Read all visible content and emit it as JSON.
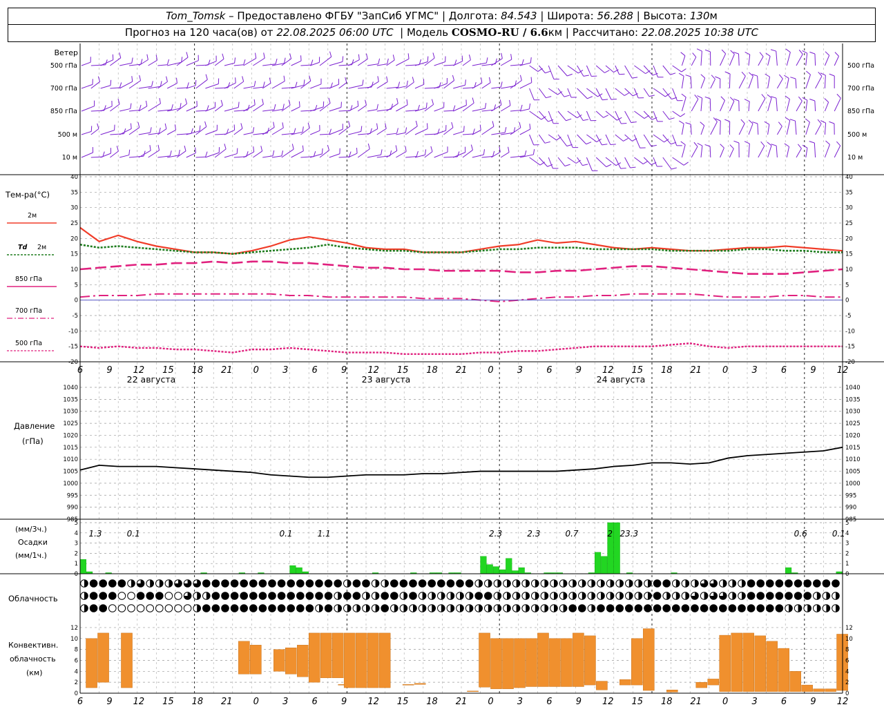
{
  "header": {
    "station": "Tom_Tomsk",
    "provider": "– Предоставлено ФГБУ \"ЗапСиб УГМС\"",
    "lon_label": "Долгота:",
    "lon": "84.543",
    "lat_label": "Широта:",
    "lat": "56.288",
    "alt_label": "Высота:",
    "alt": "130",
    "alt_unit": "м",
    "forecast_label": "Прогноз на 120 часа(ов) от",
    "issued": "22.08.2025 06:00 UTC",
    "model_label": "Модель",
    "model": "COSMO-RU / 6.6",
    "model_unit": "км",
    "calc_label": "Рассчитано:",
    "calc": "22.08.2025 10:38 UTC"
  },
  "time_axis": {
    "hour_ticks": [
      "6",
      "9",
      "12",
      "15",
      "18",
      "21",
      "0",
      "3",
      "6",
      "9",
      "12",
      "15",
      "18",
      "21",
      "0",
      "3",
      "6",
      "9",
      "12",
      "15",
      "18",
      "21",
      "0",
      "3",
      "6",
      "9",
      "12"
    ],
    "days": [
      "22 августа",
      "23 августа",
      "24 августа"
    ]
  },
  "wind_panel": {
    "title": "Ветер",
    "levels": [
      "500 гПа",
      "700 гПа",
      "850 гПа",
      "500 м",
      "10 м"
    ],
    "color": "#7a1fd0"
  },
  "temp_panel": {
    "title": "Тем-ра(°C)",
    "legend": {
      "t2m": "2м",
      "td_prefix": "Td",
      "td_suffix": "2м",
      "t850": "850 гПа",
      "t700": "700 гПа",
      "t500": "500 гПа"
    },
    "y_ticks": [
      "40",
      "35",
      "30",
      "25",
      "20",
      "15",
      "10",
      "5",
      "0",
      "-5",
      "-10",
      "-15",
      "-20"
    ]
  },
  "pressure_panel": {
    "title": "Давление",
    "unit": "(гПа)",
    "y_ticks": [
      "1040",
      "1035",
      "1030",
      "1025",
      "1020",
      "1015",
      "1010",
      "1005",
      "1000",
      "995",
      "990",
      "985"
    ]
  },
  "precip_panel": {
    "label1": "(мм/3ч.)",
    "label2": "Осадки",
    "label3": "(мм/1ч.)",
    "y_ticks": [
      "5",
      "4",
      "3",
      "2",
      "1",
      "0"
    ],
    "totals": [
      "1.3",
      "0.1",
      "0.1",
      "1.1",
      "2.3",
      "2.3",
      "0.7",
      "2",
      "23.3",
      "0.6",
      "0.1"
    ]
  },
  "cloud_panel": {
    "title": "Облачность"
  },
  "convective_panel": {
    "title1": "Конвективн.",
    "title2": "облачность",
    "title3": "(км)",
    "y_ticks": [
      "12",
      "10",
      "8",
      "6",
      "4",
      "2",
      "0"
    ]
  },
  "colors": {
    "t2m": "#f03c28",
    "td": "#1e7d1e",
    "upper": "#e0207e",
    "precip": "#22d622",
    "conv": "#f0902e",
    "pressure": "#000000"
  },
  "chart_data": [
    {
      "type": "line",
      "title": "Тем-ра(°C)",
      "x_unit": "hours since 22.08.2025 06:00 UTC",
      "x": [
        0,
        3,
        6,
        9,
        12,
        15,
        18,
        21,
        24,
        27,
        30,
        33,
        36,
        39,
        42,
        45,
        48,
        51,
        54,
        57,
        60,
        63,
        66,
        69,
        72,
        75,
        78,
        81,
        84,
        87,
        90,
        93,
        96,
        99,
        102,
        105,
        108,
        111,
        114,
        117,
        120
      ],
      "ylim": [
        -20,
        40
      ],
      "series": [
        {
          "name": "2м",
          "values": [
            23.5,
            19,
            21,
            19,
            17.5,
            16.5,
            15.5,
            15.5,
            15,
            16,
            17.5,
            19.5,
            20.5,
            19.5,
            18.5,
            17,
            16.5,
            16.5,
            15.5,
            15.5,
            15.5,
            16.5,
            17.5,
            18,
            19.5,
            18.5,
            19,
            18,
            17,
            16.5,
            17,
            16.5,
            16,
            16,
            16.5,
            17,
            17,
            17.5,
            17,
            16.5,
            16
          ]
        },
        {
          "name": "Td 2м",
          "values": [
            18,
            17,
            17.5,
            17,
            16.5,
            16,
            15.5,
            15.5,
            15,
            15.5,
            16,
            16.5,
            17,
            18,
            17,
            16.5,
            16,
            16,
            15.5,
            15.5,
            15.5,
            16,
            16.5,
            16.5,
            17,
            17,
            17,
            16.5,
            16.5,
            16.5,
            16.5,
            16,
            16,
            16,
            16,
            16.5,
            16.5,
            16,
            16,
            15.5,
            15.5
          ]
        },
        {
          "name": "850 гПа",
          "values": [
            10,
            10.5,
            11,
            11.5,
            11.5,
            12,
            12,
            12.5,
            12,
            12.5,
            12.5,
            12,
            12,
            11.5,
            11,
            10.5,
            10.5,
            10,
            10,
            9.5,
            9.5,
            9.5,
            9.5,
            9,
            9,
            9.5,
            9.5,
            10,
            10.5,
            11,
            11,
            10.5,
            10,
            9.5,
            9,
            8.5,
            8.5,
            8.5,
            9,
            9.5,
            10
          ]
        },
        {
          "name": "700 гПа",
          "values": [
            1,
            1.5,
            1.5,
            1.5,
            2,
            2,
            2,
            2,
            2,
            2,
            2,
            1.5,
            1.5,
            1,
            1,
            1,
            1,
            1,
            0.5,
            0.5,
            0.5,
            0,
            -0.5,
            0,
            0.5,
            1,
            1,
            1.5,
            1.5,
            2,
            2,
            2,
            2,
            1.5,
            1,
            1,
            1,
            1.5,
            1.5,
            1,
            1
          ]
        },
        {
          "name": "500 гПа",
          "values": [
            -15,
            -15.5,
            -15,
            -15.5,
            -15.5,
            -16,
            -16,
            -16.5,
            -17,
            -16,
            -16,
            -15.5,
            -16,
            -16.5,
            -17,
            -17,
            -17,
            -17.5,
            -17.5,
            -17.5,
            -17.5,
            -17,
            -17,
            -16.5,
            -16.5,
            -16,
            -15.5,
            -15,
            -15,
            -15,
            -15,
            -14.5,
            -14,
            -15,
            -15.5,
            -15,
            -15,
            -15,
            -15,
            -15,
            -15
          ]
        }
      ]
    },
    {
      "type": "line",
      "title": "Давление",
      "ylabel": "(гПа)",
      "x_unit": "hours since 22.08.2025 06:00 UTC",
      "x": [
        0,
        3,
        6,
        9,
        12,
        15,
        18,
        21,
        24,
        27,
        30,
        33,
        36,
        39,
        42,
        45,
        48,
        51,
        54,
        57,
        60,
        63,
        66,
        69,
        72,
        75,
        78,
        81,
        84,
        87,
        90,
        93,
        96,
        99,
        102,
        105,
        108,
        111,
        114,
        117,
        120
      ],
      "ylim": [
        985,
        1040
      ],
      "series": [
        {
          "name": "",
          "values": [
            1005.5,
            1007.5,
            1007,
            1007,
            1007,
            1006.5,
            1006,
            1005.5,
            1005,
            1004.5,
            1003.5,
            1003,
            1002.5,
            1002.5,
            1003,
            1003.5,
            1003.5,
            1003.5,
            1004,
            1004,
            1004.5,
            1005,
            1005,
            1005,
            1005,
            1005,
            1005.5,
            1006,
            1007,
            1007.5,
            1008.5,
            1008.5,
            1008,
            1008.5,
            1010.5,
            1011.5,
            1012,
            1012.5,
            1013,
            1013.5,
            1015
          ]
        }
      ]
    },
    {
      "type": "bar",
      "title": "Осадки",
      "ylabel": "(мм/3ч.) (мм/1ч.)",
      "ylim": [
        0,
        5
      ],
      "bars": [
        [
          0,
          1.4
        ],
        [
          1,
          0.2
        ],
        [
          4,
          0.1
        ],
        [
          19,
          0.1
        ],
        [
          25,
          0.1
        ],
        [
          28,
          0.1
        ],
        [
          33,
          0.8
        ],
        [
          34,
          0.6
        ],
        [
          35,
          0.2
        ],
        [
          46,
          0.1
        ],
        [
          52,
          0.1
        ],
        [
          55,
          0.1
        ],
        [
          56,
          0.1
        ],
        [
          58,
          0.1
        ],
        [
          59,
          0.1
        ],
        [
          63,
          1.7
        ],
        [
          64,
          0.9
        ],
        [
          65,
          0.7
        ],
        [
          66,
          0.4
        ],
        [
          67,
          1.5
        ],
        [
          68,
          0.3
        ],
        [
          69,
          0.6
        ],
        [
          70,
          0.1
        ],
        [
          73,
          0.1
        ],
        [
          74,
          0.1
        ],
        [
          75,
          0.1
        ],
        [
          80,
          0.1
        ],
        [
          81,
          2.1
        ],
        [
          82,
          1.7
        ],
        [
          83,
          5
        ],
        [
          84,
          5
        ],
        [
          86,
          0.1
        ],
        [
          93,
          0.1
        ],
        [
          111,
          0.6
        ],
        [
          112,
          0.1
        ],
        [
          119,
          0.2
        ]
      ],
      "bar_x_unit": "hours since 22.08.2025 06:00 UTC",
      "totals": [
        "1.3",
        "0.1",
        "0.1",
        "1.1",
        "2.3",
        "2.3",
        "0.7",
        "2",
        "23.3",
        "0.6",
        "0.1"
      ]
    },
    {
      "type": "bar",
      "title": "Конвективн. облачность",
      "ylabel": "(км)",
      "ylim": [
        0,
        12.5
      ],
      "bar_x_unit": "hours since 22.08.2025 06:00 UTC",
      "bars": [
        [
          1,
          1,
          10
        ],
        [
          3,
          2,
          11
        ],
        [
          7,
          1,
          11
        ],
        [
          27,
          3.5,
          9.5
        ],
        [
          29,
          3.5,
          8.8
        ],
        [
          33,
          4,
          8
        ],
        [
          35,
          3.5,
          8.3
        ],
        [
          37,
          3,
          8.8
        ],
        [
          39,
          2,
          11
        ],
        [
          41,
          2.8,
          11
        ],
        [
          43,
          2.8,
          11
        ],
        [
          44,
          1.5,
          1.6
        ],
        [
          45,
          1,
          11
        ],
        [
          47,
          1,
          11
        ],
        [
          49,
          1,
          11
        ],
        [
          51,
          1,
          11
        ],
        [
          55,
          1.5,
          1.6
        ],
        [
          57,
          1.6,
          1.8
        ],
        [
          66,
          0.3,
          0.4
        ],
        [
          68,
          1.1,
          11
        ],
        [
          70,
          0.8,
          10
        ],
        [
          72,
          0.8,
          10
        ],
        [
          74,
          1,
          10
        ],
        [
          76,
          1.2,
          10
        ],
        [
          78,
          1.2,
          11
        ],
        [
          80,
          1.2,
          10
        ],
        [
          82,
          1.2,
          10
        ],
        [
          84,
          1.2,
          11
        ],
        [
          86,
          1.5,
          10.5
        ],
        [
          88,
          0.6,
          2.2
        ],
        [
          92,
          1.5,
          2.5
        ],
        [
          94,
          1.5,
          10
        ],
        [
          96,
          0.5,
          11.8
        ],
        [
          100,
          0.2,
          0.6
        ],
        [
          105,
          1,
          2
        ],
        [
          107,
          1.5,
          2.6
        ],
        [
          109,
          0.3,
          10.6
        ],
        [
          111,
          0.3,
          11
        ],
        [
          113,
          0.3,
          11
        ],
        [
          115,
          0.3,
          10.5
        ],
        [
          117,
          0.3,
          9.5
        ],
        [
          119,
          0.3,
          8.2
        ],
        [
          121,
          0.3,
          4
        ],
        [
          123,
          0.3,
          1.5
        ],
        [
          125,
          0.3,
          0.8
        ],
        [
          127,
          0.3,
          0.8
        ],
        [
          129,
          0.5,
          10.8
        ]
      ]
    }
  ]
}
